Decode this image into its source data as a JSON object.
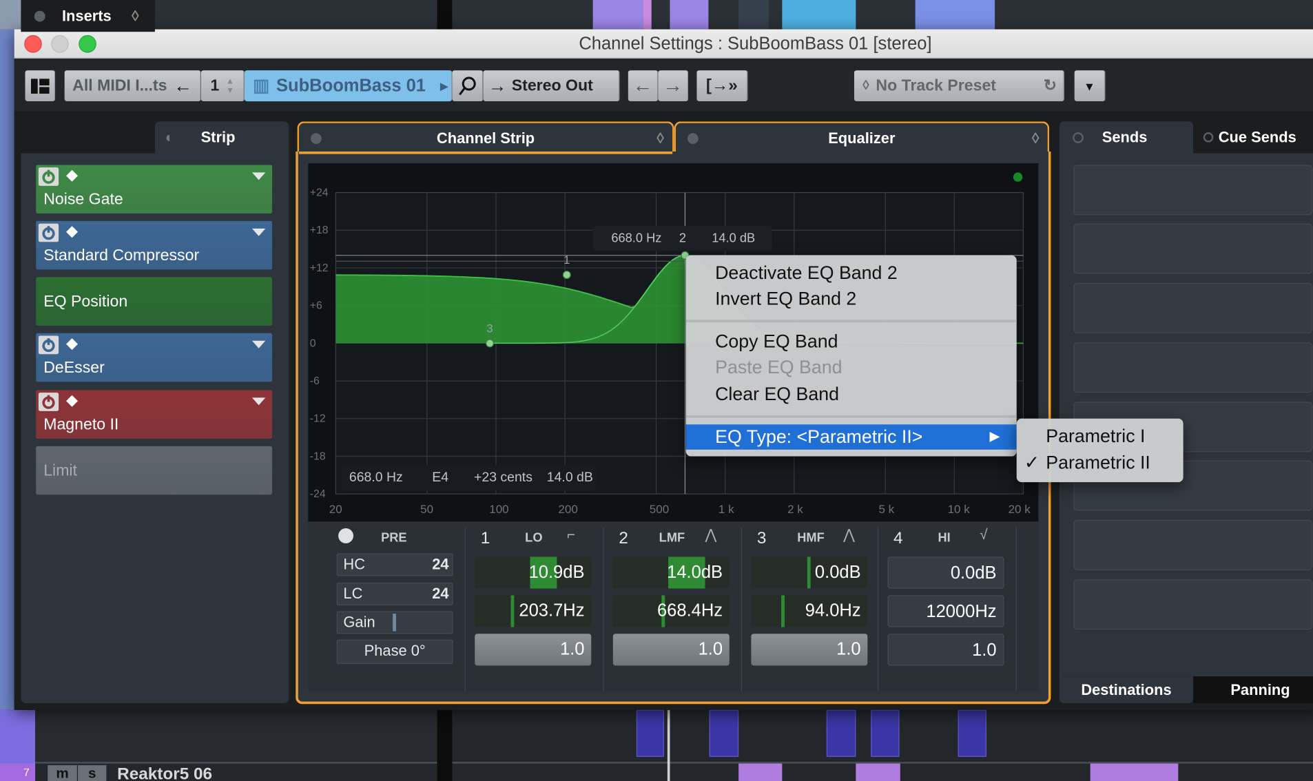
{
  "window": {
    "title": "Channel Settings : SubBoomBass 01 [stereo]"
  },
  "toolbar": {
    "visibility_filter": "All MIDI I...ts",
    "channel_number": "1",
    "channel_name": "SubBoomBass 01",
    "output": "Stereo Out",
    "track_preset": "No Track Preset"
  },
  "left_panel": {
    "tabs": [
      {
        "label": "Inserts",
        "active": false
      },
      {
        "label": "Strip",
        "active": true
      }
    ],
    "slots": [
      {
        "label": "Noise Gate",
        "color": "#3f8a47",
        "has_controls": true
      },
      {
        "label": "Standard Compressor",
        "color": "#3d6795",
        "has_controls": true
      },
      {
        "label": "EQ Position",
        "color": "#2b6e31",
        "has_controls": false
      },
      {
        "label": "DeEsser",
        "color": "#3d6795",
        "has_controls": true
      },
      {
        "label": "Magneto II",
        "color": "#8f3438",
        "has_controls": true
      },
      {
        "label": "Limit",
        "color": "#5f666e",
        "has_controls": false
      }
    ]
  },
  "center": {
    "tabs": [
      {
        "label": "Channel Strip",
        "active": false
      },
      {
        "label": "Equalizer",
        "active": true
      }
    ],
    "accent": "#f0a030"
  },
  "eq_graph": {
    "db_ticks": [
      "+24",
      "+18",
      "+12",
      "+6",
      "0",
      "-6",
      "-12",
      "-18",
      "-24"
    ],
    "freq_ticks": [
      "20",
      "50",
      "100",
      "200",
      "500",
      "1 k",
      "2 k",
      "5 k",
      "10 k",
      "20 k"
    ],
    "tooltip": {
      "freq": "668.0 Hz",
      "band": "2",
      "gain": "14.0 dB"
    },
    "readout": {
      "freq": "668.0 Hz",
      "note": "E4",
      "cents": "+23 cents",
      "gain": "14.0 dB"
    },
    "band_markers": [
      "1",
      "2",
      "3"
    ],
    "curve_color": "#2e9a34"
  },
  "eq_controls": {
    "pre": {
      "label": "PRE",
      "hc": "HC",
      "hc_slope": "24",
      "lc": "LC",
      "lc_slope": "24",
      "gain": "Gain",
      "phase": "Phase 0°"
    },
    "bands": [
      {
        "num": "1",
        "name": "LO",
        "gain": "10.9dB",
        "freq": "203.7Hz",
        "q": "1.0",
        "active": true,
        "icon": "low-shelf-icon"
      },
      {
        "num": "2",
        "name": "LMF",
        "gain": "14.0dB",
        "freq": "668.4Hz",
        "q": "1.0",
        "active": true,
        "icon": "peak-icon"
      },
      {
        "num": "3",
        "name": "HMF",
        "gain": "0.0dB",
        "freq": "94.0Hz",
        "q": "1.0",
        "active": true,
        "icon": "peak-icon"
      },
      {
        "num": "4",
        "name": "HI",
        "gain": "0.0dB",
        "freq": "12000Hz",
        "q": "1.0",
        "active": false,
        "icon": "high-shelf-icon"
      }
    ]
  },
  "context_menu": {
    "items": [
      {
        "label": "Deactivate EQ Band 2",
        "enabled": true
      },
      {
        "label": "Invert EQ Band 2",
        "enabled": true
      },
      {
        "label": "Copy EQ Band",
        "enabled": true
      },
      {
        "label": "Paste EQ Band",
        "enabled": false
      },
      {
        "label": "Clear EQ Band",
        "enabled": true
      },
      {
        "label": "EQ Type: <Parametric II>",
        "enabled": true,
        "highlighted": true
      }
    ],
    "submenu": [
      {
        "label": "Parametric I",
        "checked": false
      },
      {
        "label": "Parametric II",
        "checked": true,
        "check": "✓"
      }
    ]
  },
  "right_panel": {
    "tabs": [
      {
        "label": "Sends",
        "active": true
      },
      {
        "label": "Cue Sends",
        "active": false
      }
    ],
    "bottom_tabs": [
      {
        "label": "Destinations",
        "active": true
      },
      {
        "label": "Panning",
        "active": false
      }
    ]
  },
  "background_track": {
    "number": "7",
    "mute": "m",
    "solo": "s",
    "name": "Reaktor5 06"
  }
}
